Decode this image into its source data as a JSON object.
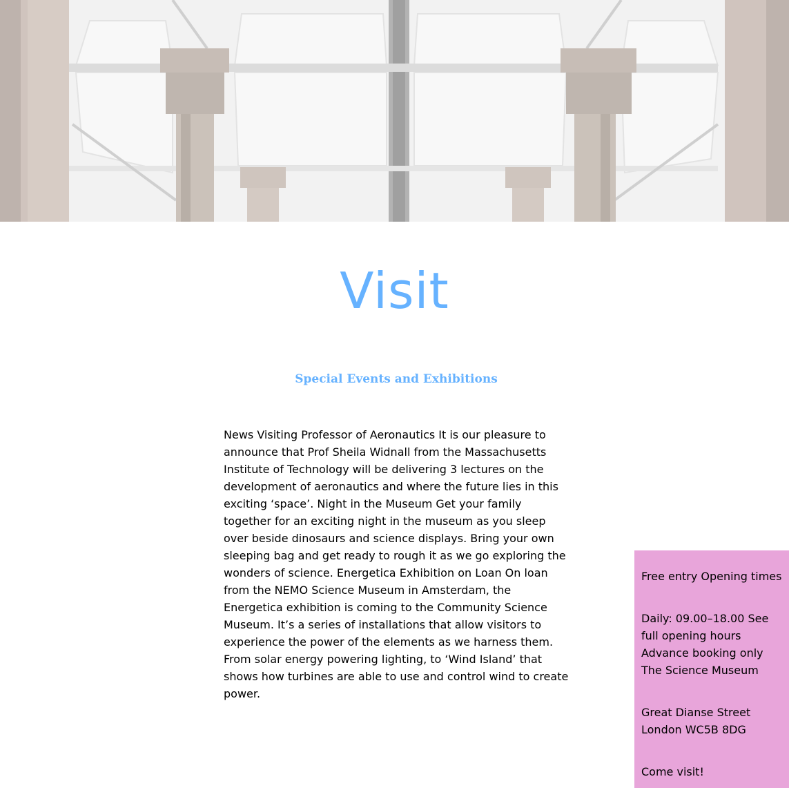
{
  "hero": {
    "image_description_icon": "museum-ceiling-columns-image"
  },
  "page": {
    "title": "Visit",
    "subtitle": "Special Events and Exhibitions",
    "body": "News Visiting Professor of Aeronautics It is our pleasure to announce that Prof Sheila Widnall from the Massachusetts Institute of Technology will be delivering 3 lectures on the development of aeronautics and where the future lies in this exciting ‘space’. Night in the Museum Get your family together for an exciting night in the museum as you sleep over beside dinosaurs and science displays. Bring your own sleeping bag and get ready to rough it as we go exploring the wonders of science. Energetica Exhibition on Loan On loan from the NEMO Science Museum in Amsterdam, the Energetica exhibition is coming to the Community Science Museum. It’s a series of installations that allow visitors to experience the power of the elements as we harness them. From solar energy powering lighting, to ‘Wind Island’ that shows how turbines are able to use and control wind to create power."
  },
  "sidebar": {
    "line1": "Free entry Opening times",
    "line2": "Daily: 09.00–18.00 See full opening hours Advance booking only The Science Museum",
    "line3": "Great Dianse Street London WC5B 8DG",
    "line4": "Come visit!"
  },
  "colors": {
    "accent": "#66b2ff",
    "sidebar_bg": "#e8a5da"
  }
}
